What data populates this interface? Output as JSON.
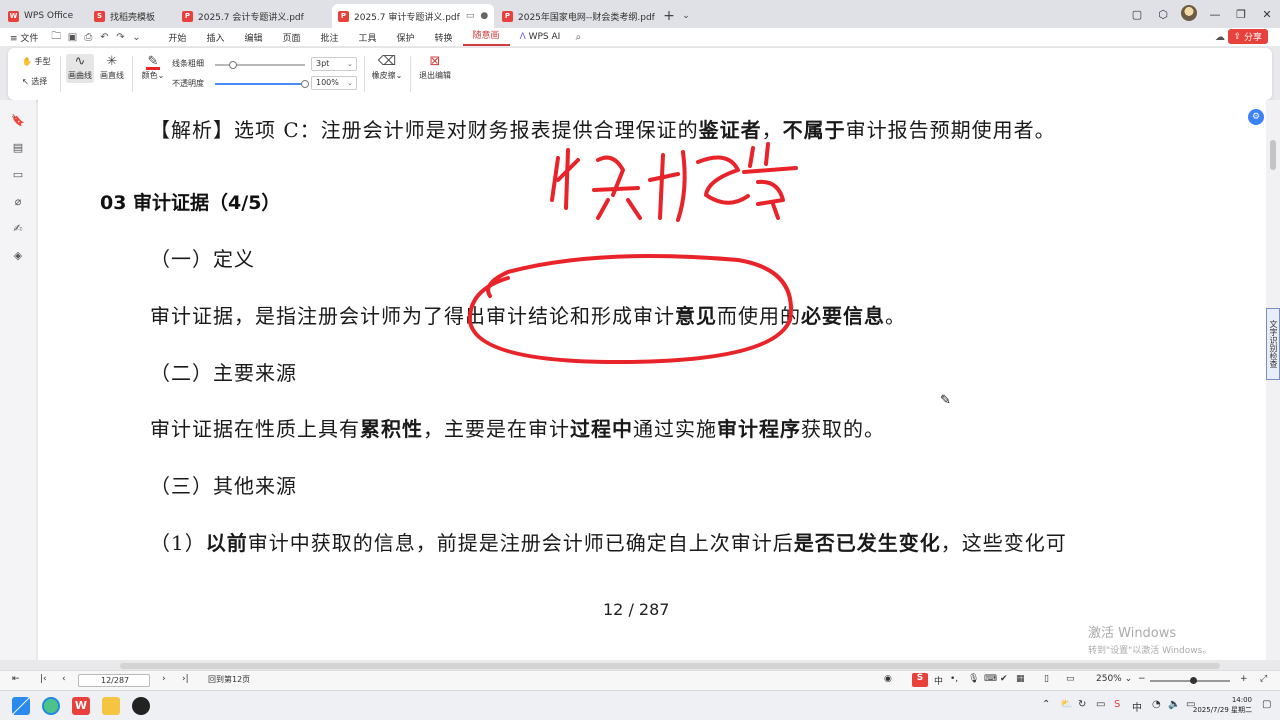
{
  "tabs": [
    {
      "label": "WPS Office",
      "icon": "wps-logo-icon",
      "color": "#e8403b"
    },
    {
      "label": "找稻壳模板",
      "icon": "docer-icon",
      "color": "#e8403b"
    },
    {
      "label": "2025.7  会计专题讲义.pdf",
      "icon": "pdf-icon",
      "color": "#e8403b"
    },
    {
      "label": "2025.7  审计专题讲义.pdf",
      "icon": "pdf-icon",
      "color": "#e8403b",
      "active": true
    },
    {
      "label": "2025年国家电网--财会类考纲.pdf",
      "icon": "pdf-icon",
      "color": "#e8403b"
    }
  ],
  "menu": {
    "file": "文件",
    "items": [
      "开始",
      "插入",
      "编辑",
      "页面",
      "批注",
      "工具",
      "保护",
      "转换",
      "随意画"
    ],
    "active": "随意画",
    "ai": "WPS AI",
    "share": "分享"
  },
  "ribbon": {
    "hand": "手型",
    "select": "选择",
    "curve": "画曲线",
    "line": "画直线",
    "color": "颜色",
    "stroke_label": "线条粗细",
    "stroke_value": "3pt",
    "opacity_label": "不透明度",
    "opacity_value": "100%",
    "eraser": "橡皮擦",
    "exit": "退出编辑"
  },
  "document": {
    "line1_pre": "【解析】选项 C：注册会计师是对财务报表提供合理保证的",
    "line1_b1": "鉴证者",
    "line1_mid": "，",
    "line1_b2": "不属于",
    "line1_post": "审计报告预期使用者。",
    "heading": "03 审计证据（4/5）",
    "sec1": "（一）定义",
    "def_pre": "审计证据，是指注册会计师为了得出审计结论和形成审计",
    "def_b1": "意见",
    "def_mid": "而使用的",
    "def_b2": "必要信息",
    "def_post": "。",
    "sec2": "（二）主要来源",
    "src_pre": "审计证据在性质上具有",
    "src_b1": "累积性",
    "src_mid1": "，主要是在审计",
    "src_b2": "过程中",
    "src_mid2": "通过实施",
    "src_b3": "审计程序",
    "src_post": "获取的。",
    "sec3": "（三）其他来源",
    "oth_pre": "（1）",
    "oth_b1": "以前",
    "oth_mid": "审计中获取的信息，前提是注册会计师已确定自上次审计后",
    "oth_b2": "是否已发生变化",
    "oth_post": "，这些变化可",
    "page_number": "12 / 287"
  },
  "side_tab": "文字识别检查",
  "watermark": {
    "title": "激活 Windows",
    "subtitle": "转到\"设置\"以激活 Windows。"
  },
  "status": {
    "page_value": "12/287",
    "back": "回到第12页",
    "zoom": "250%"
  },
  "clock": {
    "time": "14:00",
    "date": "2025/7/29 星期二"
  },
  "colors": {
    "accent": "#d13b3b",
    "annotation": "#e8232a"
  }
}
